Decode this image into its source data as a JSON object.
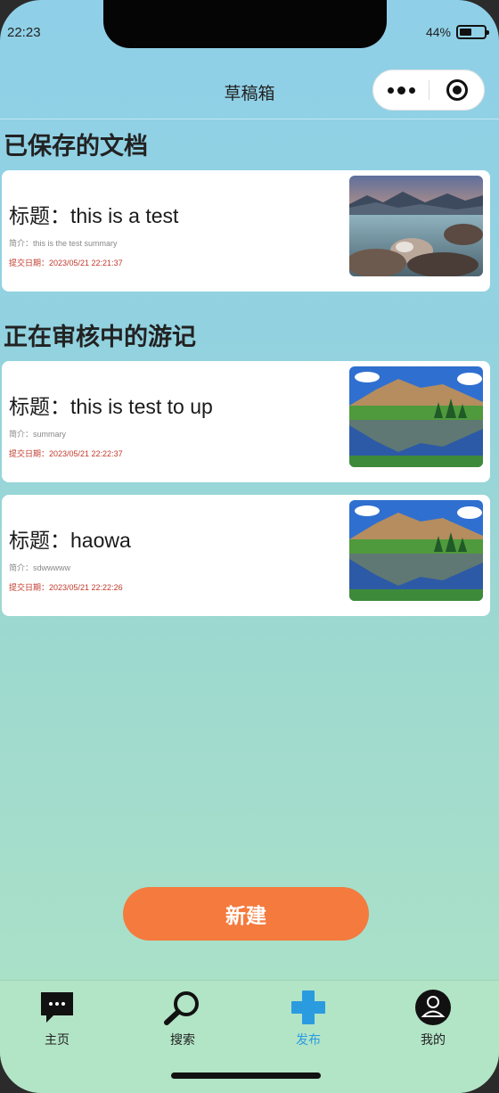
{
  "status": {
    "time": "22:23",
    "battery": "44%"
  },
  "navbar": {
    "title": "草稿箱"
  },
  "sections": {
    "saved_title": "已保存的文档",
    "review_title": "正在审核中的游记"
  },
  "saved_docs": [
    {
      "title": "标题：this is a test",
      "summary": "简介：this is the test summary",
      "date": "提交日期：2023/05/21 22:21:37",
      "thumb": "lake-sunset"
    }
  ],
  "review_docs": [
    {
      "title": "标题：this is test to up",
      "summary": "简介：summary",
      "date": "提交日期：2023/05/21 22:22:37",
      "thumb": "mountain-lake"
    },
    {
      "title": "标题：haowa",
      "summary": "简介：sdwwwww",
      "date": "提交日期：2023/05/21 22:22:26",
      "thumb": "mountain-lake"
    }
  ],
  "new_button": {
    "label": "新建",
    "color": "#f47a3e"
  },
  "tabbar": {
    "items": [
      {
        "label": "主页",
        "icon": "chat-bubble-icon"
      },
      {
        "label": "搜索",
        "icon": "search-icon"
      },
      {
        "label": "发布",
        "icon": "plus-icon",
        "active": true,
        "color": "#2b9be0"
      },
      {
        "label": "我的",
        "icon": "user-avatar-icon"
      }
    ]
  }
}
